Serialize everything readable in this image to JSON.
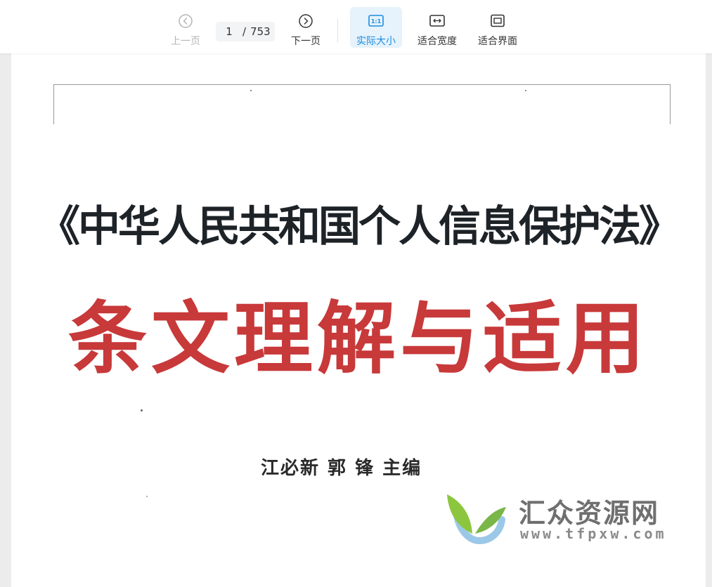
{
  "toolbar": {
    "prev_label": "上一页",
    "current_page": "1",
    "total_pages": "753",
    "next_label": "下一页",
    "actual_size_label": "实际大小",
    "actual_size_icon_text": "1:1",
    "fit_width_label": "适合宽度",
    "fit_page_label": "适合界面"
  },
  "document": {
    "title_line1": "《中华人民共和国个人信息保护法》",
    "title_line2": "条文理解与适用",
    "authors": "江必新  郭  锋  主编"
  },
  "watermark": {
    "name": "汇众资源网",
    "url": "www.tfpxw.com"
  },
  "colors": {
    "accent": "#1a8de0",
    "title_red": "#c8393a",
    "title_dark": "#1e2328"
  }
}
